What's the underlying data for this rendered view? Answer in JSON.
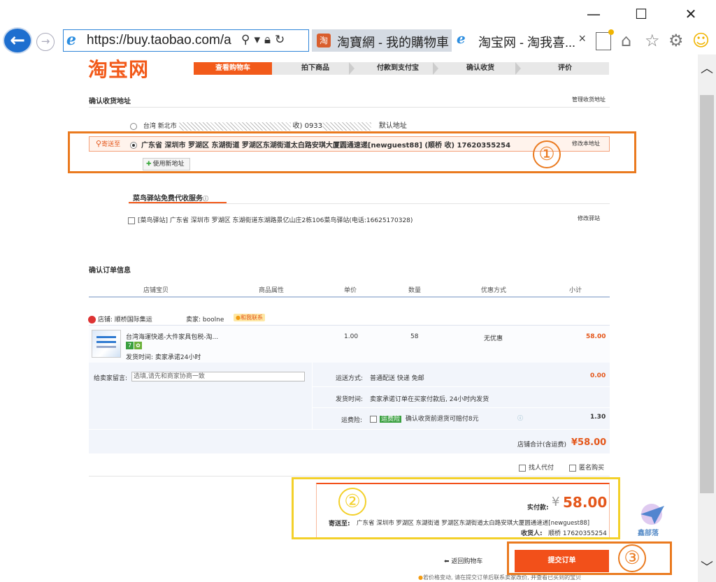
{
  "window": {
    "minimize": "—",
    "maximize": "☐",
    "close": "✕"
  },
  "browser": {
    "url": "https://buy.taobao.com/a",
    "tabs": [
      {
        "label": "淘寶網 - 我的購物車",
        "active": true
      },
      {
        "label": "淘宝网 - 淘我喜...",
        "active": false
      }
    ]
  },
  "page": {
    "logo": "淘宝网",
    "steps": [
      "查看购物车",
      "拍下商品",
      "付款到支付宝",
      "确认收货",
      "评价"
    ],
    "address_section": {
      "title": "确认收货地址",
      "manage_link": "管理收货地址",
      "addr1": {
        "prefix": "台湾 新北市",
        "masked_suffix": "收) 0933",
        "default_label": "默认地址"
      },
      "addr2": {
        "send_to": "寄送至",
        "text": "广东省 深圳市 罗湖区 东湖街道 罗湖区东湖街道太白路安琪大厦圆通速递[newguest88] (顺桥 收) 17620355254",
        "edit_link": "修改本地址"
      },
      "use_new": "使用新地址"
    },
    "cainiao": {
      "title": "菜鸟驿站免费代收服务",
      "station_text": "[菜鸟驿站] 广东省 深圳市 罗湖区 东湖街道东湖路景亿山庄2栋106菜鸟驿站(电话:16625170328)",
      "edit_link": "修改驿站"
    },
    "order": {
      "title": "确认订单信息",
      "headers": [
        "店铺宝贝",
        "商品属性",
        "单价",
        "数量",
        "优惠方式",
        "小计"
      ],
      "shop_label": "店铺: 顺桥国际集运",
      "seller_label": "卖家: boolne",
      "contact_label": "和我联系",
      "item": {
        "name": "台湾海運快遞-大件家具包税-淘...",
        "ship_time": "发货时间: 卖家承诺24小时",
        "price": "1.00",
        "qty": "58",
        "discount": "无优惠",
        "subtotal": "58.00"
      },
      "message_label": "给卖家留言:",
      "message_placeholder": "选填,请先和商家协商一致",
      "shipping_label": "运送方式:",
      "shipping_value": "普通配送 快递 免邮",
      "shipping_cost": "0.00",
      "ship_time_label": "发货时间:",
      "ship_time_value": "卖家承诺订单在买家付款后, 24小时内发货",
      "insurance_label": "运费险:",
      "insurance_badge": "运费险",
      "insurance_text": "确认收货前退货可赔付8元",
      "insurance_price": "1.30",
      "shop_total_label": "店铺合计(含运费)",
      "shop_total": "¥58.00",
      "proxy_pay": "找人代付",
      "anonymous": "匿名购买"
    },
    "summary": {
      "pay_label": "实付款:",
      "currency": "¥",
      "amount": "58.00",
      "send_to_label": "寄送至:",
      "send_to": "广东省 深圳市 罗湖区 东湖街道 罗湖区东湖街道太白路安琪大厦圆通速递[newguest88]",
      "receiver_label": "收货人:",
      "receiver": "顺桥 17620355254"
    },
    "back_link": "返回购物车",
    "submit": "提交订单",
    "footer_note": "若价格变动, 请在提交订单后联系卖家改价, 并查看已买到的宝贝"
  },
  "annotations": {
    "one": "①",
    "two": "②",
    "three": "③"
  },
  "watermark": "鑫部落"
}
